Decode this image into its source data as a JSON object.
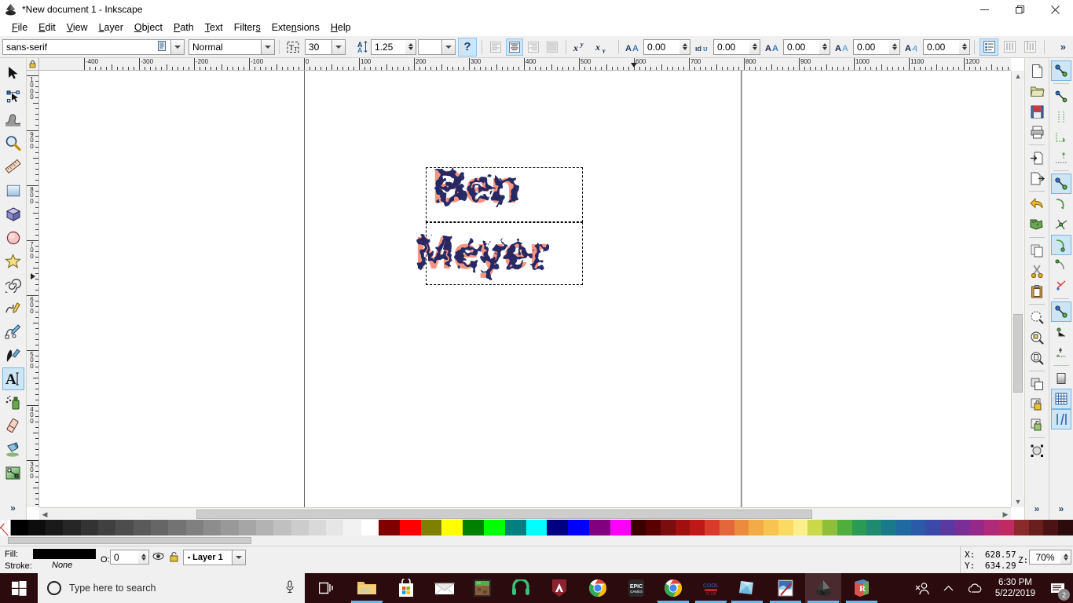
{
  "window": {
    "title": "*New document 1 - Inkscape",
    "app_icon": "inkscape-icon",
    "minimize_label": "Minimize",
    "maximize_label": "Restore",
    "close_label": "Close"
  },
  "menubar": {
    "items": [
      {
        "label": "File",
        "accel": "F"
      },
      {
        "label": "Edit",
        "accel": "E"
      },
      {
        "label": "View",
        "accel": "V"
      },
      {
        "label": "Layer",
        "accel": "L"
      },
      {
        "label": "Object",
        "accel": "O"
      },
      {
        "label": "Path",
        "accel": "P"
      },
      {
        "label": "Text",
        "accel": "T"
      },
      {
        "label": "Filters",
        "accel": "s"
      },
      {
        "label": "Extensions",
        "accel": "n"
      },
      {
        "label": "Help",
        "accel": "H"
      }
    ]
  },
  "text_toolbar": {
    "font_family": "sans-serif",
    "font_family_placeholder": "Font family",
    "font_style": "Normal",
    "font_size": "30",
    "font_size_unit": "",
    "spacing_between_lines": "1.25",
    "line_unit": "",
    "help_button": "?",
    "align_options": [
      "align-left",
      "align-center",
      "align-right",
      "align-justify"
    ],
    "align_selected": "align-center",
    "superscript": "xʸ",
    "subscript": "xᵧ",
    "letter_spacing": "0.00",
    "word_spacing": "0.00",
    "horizontal_kerning": "0.00",
    "vertical_shift": "0.00",
    "character_rotation": "0.00",
    "writing_modes": [
      "horizontal-text",
      "vertical-text-rl",
      "vertical-text-lr"
    ],
    "writing_mode_selected": "horizontal-text",
    "overflow": "»"
  },
  "toolbox": {
    "tools": [
      {
        "name": "selector-tool",
        "label": "Selector"
      },
      {
        "name": "node-tool",
        "label": "Node editor"
      },
      {
        "name": "tweak-tool",
        "label": "Tweak"
      },
      {
        "name": "zoom-tool",
        "label": "Zoom"
      },
      {
        "name": "measure-tool",
        "label": "Measure"
      },
      {
        "name": "rectangle-tool",
        "label": "Rectangle"
      },
      {
        "name": "box3d-tool",
        "label": "3D Box"
      },
      {
        "name": "ellipse-tool",
        "label": "Ellipse"
      },
      {
        "name": "star-tool",
        "label": "Star"
      },
      {
        "name": "spiral-tool",
        "label": "Spiral"
      },
      {
        "name": "pencil-tool",
        "label": "Pencil"
      },
      {
        "name": "bezier-tool",
        "label": "Bezier / pen"
      },
      {
        "name": "calligraphy-tool",
        "label": "Calligraphy"
      },
      {
        "name": "text-tool",
        "label": "Text",
        "selected": true
      },
      {
        "name": "spray-tool",
        "label": "Spray"
      },
      {
        "name": "eraser-tool",
        "label": "Eraser"
      },
      {
        "name": "paintbucket-tool",
        "label": "Paint bucket"
      },
      {
        "name": "gradient-tool",
        "label": "Gradient"
      }
    ],
    "overflow": "»"
  },
  "command_bar": {
    "buttons": [
      {
        "name": "new-document-button"
      },
      {
        "name": "open-document-button"
      },
      {
        "name": "save-document-button"
      },
      {
        "name": "print-document-button"
      },
      {
        "name": "import-button"
      },
      {
        "name": "export-button"
      },
      {
        "name": "undo-button"
      },
      {
        "name": "redo-button"
      },
      {
        "name": "copy-button"
      },
      {
        "name": "cut-button"
      },
      {
        "name": "paste-button"
      },
      {
        "name": "zoom-selection-button"
      },
      {
        "name": "zoom-drawing-button"
      },
      {
        "name": "zoom-page-button"
      },
      {
        "name": "duplicate-button"
      },
      {
        "name": "group-button"
      },
      {
        "name": "ungroup-button"
      },
      {
        "name": "objects-transform-button"
      }
    ],
    "overflow": "»"
  },
  "snap_bar": {
    "buttons": [
      {
        "name": "snap-enable-button",
        "active": true
      },
      {
        "name": "snap-bounding-box-button"
      },
      {
        "name": "snap-bbox-edge-button"
      },
      {
        "name": "snap-bbox-corner-button"
      },
      {
        "name": "snap-bbox-edge-midpoint-button"
      },
      {
        "name": "snap-nodes-button",
        "active": true
      },
      {
        "name": "snap-path-button"
      },
      {
        "name": "snap-path-intersection-button"
      },
      {
        "name": "snap-cusp-node-button",
        "active": true
      },
      {
        "name": "snap-smooth-node-button"
      },
      {
        "name": "snap-midpoint-button"
      },
      {
        "name": "snap-others-button"
      },
      {
        "name": "snap-object-center-button"
      },
      {
        "name": "snap-text-baseline-button"
      },
      {
        "name": "snap-page-border-button"
      },
      {
        "name": "snap-grid-button",
        "active": true
      },
      {
        "name": "snap-guide-button",
        "active": true
      }
    ],
    "overflow": "»"
  },
  "rulers": {
    "unit": "px",
    "horizontal_labels": [
      "-400",
      "-300",
      "-200",
      "-100",
      "0",
      "100",
      "200",
      "300",
      "400",
      "500",
      "600",
      "700",
      "800",
      "900",
      "1000",
      "1100",
      "1200"
    ],
    "vertical_labels": [
      "1000",
      "900",
      "800",
      "700",
      "600",
      "500",
      "400",
      "300"
    ]
  },
  "canvas": {
    "text_object": {
      "line1": "Ben",
      "line2": "Meyer",
      "fill_color": "#f59480",
      "filter_color": "#1e2060",
      "selection": "dashed"
    }
  },
  "status_bar": {
    "fill_label": "Fill:",
    "stroke_label": "Stroke:",
    "fill_value": "#000000",
    "stroke_value": "None",
    "opacity_label": "O:",
    "opacity_value": "0",
    "layer_name": "Layer 1",
    "layer_visibility_icon": "eye-icon",
    "layer_lock_icon": "lock-icon",
    "x_label": "X:",
    "x_value": "628.57",
    "y_label": "Y:",
    "y_value": "634.29",
    "zoom_label": "Z:",
    "zoom_value": "70%"
  },
  "palette": {
    "colors": [
      "#000000",
      "#0d0d0d",
      "#1a1a1a",
      "#262626",
      "#333333",
      "#404040",
      "#4d4d4d",
      "#5a5a5a",
      "#666666",
      "#737373",
      "#808080",
      "#8d8d8d",
      "#999999",
      "#a6a6a6",
      "#b3b3b3",
      "#c0c0c0",
      "#cccccc",
      "#d9d9d9",
      "#e6e6e6",
      "#f2f2f2",
      "#ffffff",
      "#800000",
      "#ff0000",
      "#808000",
      "#ffff00",
      "#008000",
      "#00ff00",
      "#008080",
      "#00ffff",
      "#000080",
      "#0000ff",
      "#800080",
      "#ff00ff"
    ],
    "none_swatch": "X"
  },
  "taskbar": {
    "start_label": "Start",
    "search_placeholder": "Type here to search",
    "mic_icon": "microphone-icon",
    "task_view_icon": "task-view-icon",
    "apps": [
      {
        "name": "file-explorer",
        "label": "File Explorer"
      },
      {
        "name": "microsoft-store",
        "label": "Microsoft Store"
      },
      {
        "name": "mail",
        "label": "Mail"
      },
      {
        "name": "minecraft",
        "label": "Minecraft"
      },
      {
        "name": "discord",
        "label": "Discord"
      },
      {
        "name": "apex-legends",
        "label": "Apex Legends"
      },
      {
        "name": "chrome",
        "label": "Google Chrome"
      },
      {
        "name": "epic-games",
        "label": "Epic Games Launcher"
      },
      {
        "name": "chrome-2",
        "label": "Google Chrome"
      },
      {
        "name": "gaming-app",
        "label": "Gaming"
      },
      {
        "name": "sticky-notes",
        "label": "Sticky Notes"
      },
      {
        "name": "paint",
        "label": "Paint"
      },
      {
        "name": "inkscape",
        "label": "Inkscape",
        "active": true
      },
      {
        "name": "roblox",
        "label": "Roblox Studio"
      }
    ],
    "tray": [
      {
        "name": "people-icon"
      },
      {
        "name": "show-hidden-icons-chevron"
      },
      {
        "name": "onedrive-icon"
      }
    ],
    "time": "6:30 PM",
    "date": "5/22/2019",
    "notification_count": "2"
  }
}
